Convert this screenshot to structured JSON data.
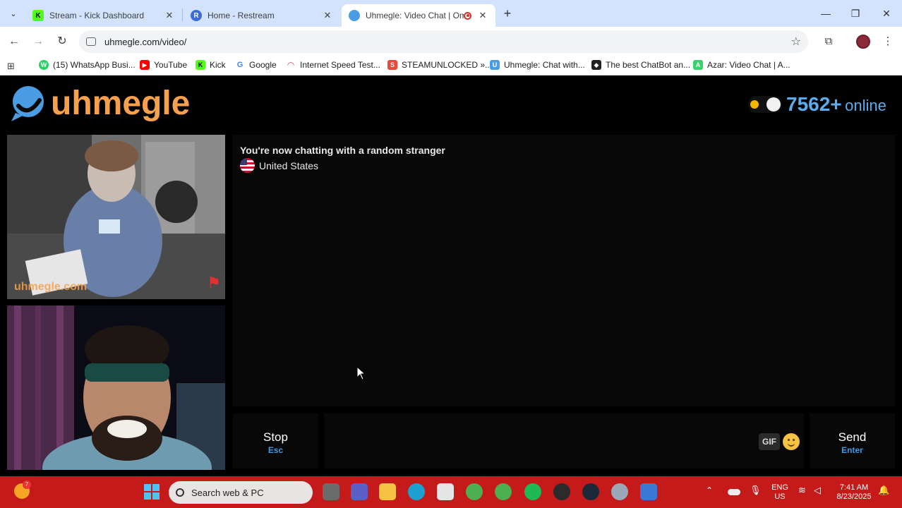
{
  "browser": {
    "tabs": [
      {
        "title": "Stream - Kick Dashboard",
        "favicon": "K",
        "favicon_color": "#53fc18"
      },
      {
        "title": "Home - Restream",
        "favicon": "R",
        "favicon_color": "#3d6bdb"
      },
      {
        "title": "Uhmegle: Video Chat | Ome",
        "favicon": "",
        "favicon_color": "#4a9ce3"
      }
    ],
    "url": "uhmegle.com/video/",
    "bookmarks": [
      {
        "label": "(15) WhatsApp Busi...",
        "color": "#25d366",
        "glyph": "W"
      },
      {
        "label": "YouTube",
        "color": "#ff0000",
        "glyph": "▶"
      },
      {
        "label": "Kick",
        "color": "#53fc18",
        "glyph": "K"
      },
      {
        "label": "Google",
        "color": "#4285f4",
        "glyph": "G"
      },
      {
        "label": "Internet Speed Test...",
        "color": "#d34e6a",
        "glyph": "◠"
      },
      {
        "label": "STEAMUNLOCKED »...",
        "color": "#e8493a",
        "glyph": "S"
      },
      {
        "label": "Uhmegle: Chat with...",
        "color": "#4a9ce3",
        "glyph": "U"
      },
      {
        "label": "The best ChatBot an...",
        "color": "#222222",
        "glyph": "◆"
      },
      {
        "label": "Azar: Video Chat | A...",
        "color": "#36d46b",
        "glyph": "A"
      }
    ]
  },
  "site": {
    "logo_text": "uhmegle",
    "online_count": "7562+",
    "online_label": "online"
  },
  "videos": {
    "stranger_watermark": "uhmegle.com"
  },
  "chat": {
    "status": "You're now chatting with a random stranger",
    "country": "United States"
  },
  "controls": {
    "stop_label": "Stop",
    "stop_key": "Esc",
    "gif_label": "GIF",
    "send_label": "Send",
    "send_key": "Enter"
  },
  "taskbar": {
    "search_placeholder": "Search web & PC",
    "notification_badge": "7",
    "lang_line1": "ENG",
    "lang_line2": "US",
    "time": "7:41 AM",
    "date": "8/23/2025"
  }
}
